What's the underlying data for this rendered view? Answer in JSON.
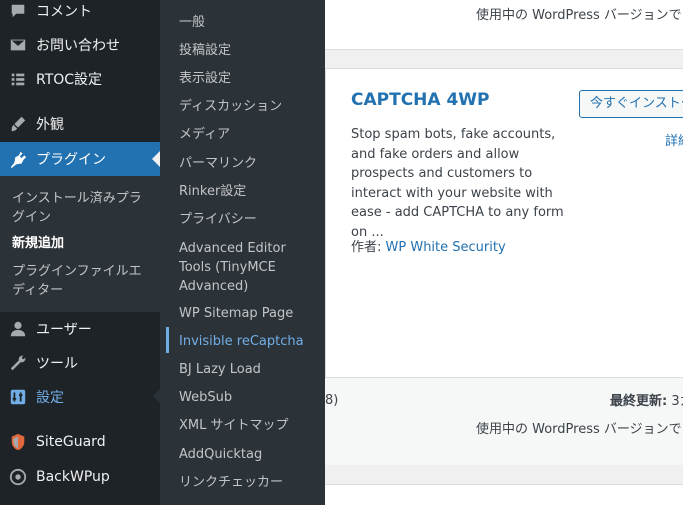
{
  "sidebar": {
    "items": [
      {
        "label": "コメント",
        "icon": "comment-icon"
      },
      {
        "label": "お問い合わせ",
        "icon": "mail-icon"
      },
      {
        "label": "RTOC設定",
        "icon": "list-icon"
      },
      {
        "label": "外観",
        "icon": "paintbrush-icon"
      },
      {
        "label": "プラグイン",
        "icon": "plugin-icon"
      },
      {
        "label": "ユーザー",
        "icon": "user-icon"
      },
      {
        "label": "ツール",
        "icon": "wrench-icon"
      },
      {
        "label": "設定",
        "icon": "settings-sliders-icon"
      },
      {
        "label": "SiteGuard",
        "icon": "siteguard-icon"
      },
      {
        "label": "BackWPup",
        "icon": "backwpup-icon"
      }
    ],
    "plugin_submenu": [
      {
        "label": "インストール済みプラグイン"
      },
      {
        "label": "新規追加"
      },
      {
        "label": "プラグインファイルエディター"
      }
    ]
  },
  "settings_flyout": {
    "items": [
      {
        "label": "一般"
      },
      {
        "label": "投稿設定"
      },
      {
        "label": "表示設定"
      },
      {
        "label": "ディスカッション"
      },
      {
        "label": "メディア"
      },
      {
        "label": "パーマリンク"
      },
      {
        "label": "Rinker設定"
      },
      {
        "label": "プライバシー"
      },
      {
        "label": "Advanced Editor Tools (TinyMCE Advanced)"
      },
      {
        "label": "WP Sitemap Page"
      },
      {
        "label": "Invisible reCaptcha"
      },
      {
        "label": "BJ Lazy Load"
      },
      {
        "label": "WebSub"
      },
      {
        "label": "XML サイトマップ"
      },
      {
        "label": "AddQuicktag"
      },
      {
        "label": "リンクチェッカー"
      }
    ]
  },
  "content": {
    "top_card": {
      "compat": "使用中の WordPress バージョンで"
    },
    "plugin": {
      "title": "CAPTCHA 4WP",
      "install_label": "今すぐインストー",
      "details_label": "詳細",
      "description": "Stop spam bots, fake accounts, and fake orders and allow prospects and customers to interact with your website with ease - add CAPTCHA to any form on ...",
      "author_prefix": "作者: ",
      "author_name": "WP White Security",
      "rating_fragment": "8)",
      "last_updated_label": "最終更新:",
      "last_updated_value": " 3カ",
      "compat": "使用中の WordPress バージョンで"
    }
  },
  "colors": {
    "sidebar_bg": "#1d2327",
    "submenu_bg": "#2c3338",
    "accent": "#2271b1",
    "highlight_text": "#72aee6"
  }
}
